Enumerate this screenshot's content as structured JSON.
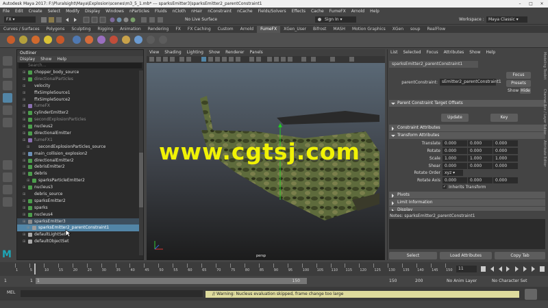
{
  "window": {
    "title": "Autodesk Maya 2017: F:\\Pluralsight\\Maya\\Explosion\\scenes\\m3_5_1.mb*   ---   sparksEmitter3|sparksEmitter2_parentConstraint1"
  },
  "menubar": [
    "File",
    "Edit",
    "Create",
    "Select",
    "Modify",
    "Display",
    "Windows",
    "nParticles",
    "Fluids",
    "nCloth",
    "nHair",
    "nConstraint",
    "nCache",
    "Fields/Solvers",
    "Effects",
    "Cache",
    "FumeFX",
    "Arnold",
    "Help"
  ],
  "statusline": {
    "mode": "FX",
    "live_surface": "No Live Surface",
    "sign_in": "Sign In",
    "workspace_label": "Workspace :",
    "workspace_value": "Maya Classic"
  },
  "shelf_tabs": [
    "Curves / Surfaces",
    "Polygons",
    "Sculpting",
    "Rigging",
    "Animation",
    "Rendering",
    "FX",
    "FX Caching",
    "Custom",
    "Arnold",
    "FumeFX",
    "XGen_User",
    "Bifrost",
    "MASH",
    "Motion Graphics",
    "XGen",
    "soup",
    "RealFlow"
  ],
  "shelf_active": "FumeFX",
  "outliner": {
    "title": "Outliner",
    "menus": [
      "Display",
      "Show",
      "Help"
    ],
    "search_placeholder": "Search...",
    "items": [
      {
        "label": "chopper_body_source",
        "grey": false,
        "icon": "#4c9e4c",
        "indent": 1,
        "state": ""
      },
      {
        "label": "directionalParticles",
        "grey": true,
        "icon": "#4c9e4c",
        "indent": 1,
        "state": ""
      },
      {
        "label": "velocity",
        "grey": false,
        "icon": "",
        "indent": 1,
        "state": ""
      },
      {
        "label": "ffxSimpleSource1",
        "grey": false,
        "icon": "",
        "indent": 1,
        "state": ""
      },
      {
        "label": "ffxSimpleSource2",
        "grey": false,
        "icon": "",
        "indent": 1,
        "state": ""
      },
      {
        "label": "fumeFX",
        "grey": true,
        "icon": "#8a6fb0",
        "indent": 1,
        "state": ""
      },
      {
        "label": "cylinderEmitter2",
        "grey": false,
        "icon": "#4c9e4c",
        "indent": 1,
        "state": ""
      },
      {
        "label": "secondExplosionParticles",
        "grey": true,
        "icon": "#4c9e4c",
        "indent": 1,
        "state": ""
      },
      {
        "label": "nucleus2",
        "grey": false,
        "icon": "#4c9e4c",
        "indent": 1,
        "state": ""
      },
      {
        "label": "directionalEmitter",
        "grey": false,
        "icon": "#4c9e4c",
        "indent": 1,
        "state": ""
      },
      {
        "label": "fumeFX1",
        "grey": true,
        "icon": "#8a6fb0",
        "indent": 1,
        "state": ""
      },
      {
        "label": "secondExplosionParticles_source",
        "grey": false,
        "icon": "",
        "indent": 2,
        "state": ""
      },
      {
        "label": "main_collision_explosion2",
        "grey": false,
        "icon": "#6b8fb8",
        "indent": 1,
        "state": ""
      },
      {
        "label": "directionalEmitter2",
        "grey": false,
        "icon": "#4c9e4c",
        "indent": 1,
        "state": ""
      },
      {
        "label": "debrisEmitter2",
        "grey": false,
        "icon": "#4c9e4c",
        "indent": 1,
        "state": ""
      },
      {
        "label": "debris",
        "grey": false,
        "icon": "#4c9e4c",
        "indent": 1,
        "state": ""
      },
      {
        "label": "sparksParticleEmitter2",
        "grey": false,
        "icon": "#4c9e4c",
        "indent": 2,
        "state": ""
      },
      {
        "label": "nucleus3",
        "grey": false,
        "icon": "#4c9e4c",
        "indent": 1,
        "state": ""
      },
      {
        "label": "debris_source",
        "grey": false,
        "icon": "",
        "indent": 1,
        "state": ""
      },
      {
        "label": "sparksEmitter2",
        "grey": false,
        "icon": "#4c9e4c",
        "indent": 1,
        "state": ""
      },
      {
        "label": "sparks",
        "grey": false,
        "icon": "#4c9e4c",
        "indent": 1,
        "state": ""
      },
      {
        "label": "nucleus4",
        "grey": false,
        "icon": "#4c9e4c",
        "indent": 1,
        "state": ""
      },
      {
        "label": "sparksEmitter3",
        "grey": false,
        "icon": "#8c8c8c",
        "indent": 1,
        "state": "hl"
      },
      {
        "label": "sparksEmitter2_parentConstraint1",
        "grey": false,
        "icon": "#9c9c9c",
        "indent": 2,
        "state": "sel"
      },
      {
        "label": "defaultLightSet",
        "grey": false,
        "icon": "#aaaaaa",
        "indent": 1,
        "state": ""
      },
      {
        "label": "defaultObjectSet",
        "grey": false,
        "icon": "#aaaaaa",
        "indent": 1,
        "state": ""
      }
    ]
  },
  "viewport": {
    "menus": [
      "View",
      "Shading",
      "Lighting",
      "Show",
      "Renderer",
      "Panels"
    ],
    "camera_label": "persp",
    "watermark": "www.cgtsj.com"
  },
  "attribute_editor": {
    "menus": [
      "List",
      "Selected",
      "Focus",
      "Attributes",
      "Show",
      "Help"
    ],
    "node_tab": "sparksEmitter2_parentConstraint1",
    "node_type_label": "parentConstraint:",
    "node_name_value": "sEmitter2_parentConstraint1",
    "focus_label": "Focus",
    "presets_label": "Presets",
    "show_label": "Show",
    "hide_label": "Hide",
    "sections": {
      "target_offsets": "Parent Constraint Target Offsets",
      "constraint_attrs": "Constraint Attributes",
      "transform_attrs": "Transform Attributes",
      "pivots": "Pivots",
      "limit_info": "Limit Information",
      "display": "Display"
    },
    "update_label": "Update",
    "key_label": "Key",
    "transform_rows": [
      {
        "label": "Translate",
        "values": [
          "0.000",
          "0.000",
          "0.000"
        ]
      },
      {
        "label": "Rotate",
        "values": [
          "0.000",
          "0.000",
          "0.000"
        ]
      },
      {
        "label": "Scale",
        "values": [
          "1.000",
          "1.000",
          "1.000"
        ]
      },
      {
        "label": "Shear",
        "values": [
          "0.000",
          "0.000",
          "0.000"
        ]
      }
    ],
    "rotate_order_label": "Rotate Order",
    "rotate_order_value": "xyz",
    "rotate_axis_label": "Rotate Axis",
    "rotate_axis_values": [
      "0.000",
      "0.000",
      "0.000"
    ],
    "inherits_label": "Inherits Transform",
    "notes_label": "Notes: sparksEmitter2_parentConstraint1",
    "footer_buttons": [
      "Select",
      "Load Attributes",
      "Copy Tab"
    ]
  },
  "time_slider": {
    "ticks": [
      "1",
      "5",
      "10",
      "15",
      "20",
      "25",
      "30",
      "35",
      "40",
      "45",
      "50",
      "55",
      "60",
      "65",
      "70",
      "75",
      "80",
      "85",
      "90",
      "95",
      "100",
      "105",
      "110",
      "115",
      "120",
      "125",
      "130",
      "135",
      "140",
      "145",
      "150"
    ],
    "current_frame": "11",
    "fps_label": "11"
  },
  "range_slider": {
    "start": "1",
    "inner_start": "1",
    "playback_start": "1",
    "playback_end": "150",
    "end_a": "150",
    "end_b": "200",
    "anim_layer": "No Anim Layer",
    "character_set": "No Character Set"
  },
  "command_line": {
    "mode": "MEL",
    "warning": "// Warning: Nucleus evaluation skipped, frame change too large"
  },
  "colors": {
    "selection": "#5285a6",
    "warning_bg": "#dedb9d",
    "watermark": "#f0f205",
    "maya_logo": "#1ea5b5"
  },
  "side_tabs": [
    "Modeling Toolkit",
    "Channel Box / Layer Editor",
    "Attribute Editor"
  ]
}
